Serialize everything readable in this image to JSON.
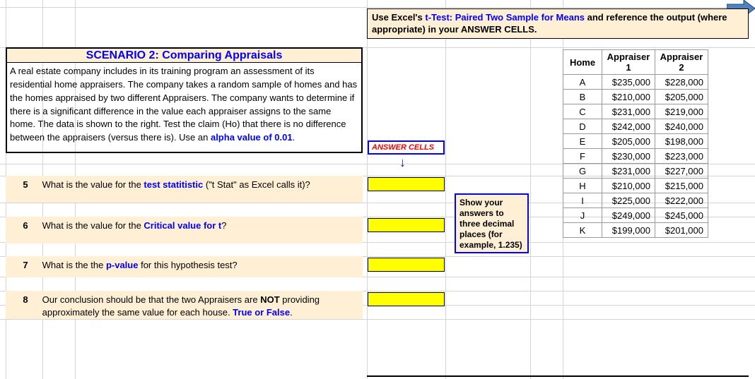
{
  "instruction": {
    "pre": "Use Excel's ",
    "blue": "t-Test: Paired Two Sample for Means",
    "post": " and reference the output (where appropriate) in your ANSWER CELLS."
  },
  "scenario": {
    "title": "SCENARIO 2: Comparing Appraisals",
    "body_pre": "A real estate company includes in its training program an assessment of its residential home appraisers.  The company takes a random sample of homes and has the homes appraised by two different Appraisers.  The company wants to determine if there is a significant difference in the value each appraiser assigns to the same home.  The data is shown to the right.  Test the claim (Ho) that there is no difference between the appraisers (versus there is).  Use an ",
    "body_blue": "alpha value of 0.01",
    "body_post": "."
  },
  "answer_label": "ANSWER CELLS",
  "note": "Show your answers to three decimal places (for example, 1.235)",
  "questions": {
    "q5": {
      "num": "5",
      "pre": "What is the value for the ",
      "blue": "test statitistic",
      "post": " (\"t Stat\" as Excel calls it)?"
    },
    "q6": {
      "num": "6",
      "pre": "What is the value for the ",
      "blue": "Critical value for t",
      "post": "?"
    },
    "q7": {
      "num": "7",
      "pre": "What is the the ",
      "blue": "p-value",
      "post": " for this hypothesis test?"
    },
    "q8": {
      "num": "8",
      "pre1": "Our conclusion should be that the two Appraisers are ",
      "bold": "NOT",
      "pre2": " providing approximately the same value for each house.  ",
      "blue": "True or False",
      "post": "."
    }
  },
  "table": {
    "headers": {
      "h1": "Home",
      "h2": "Appraiser 1",
      "h3": "Appraiser 2"
    },
    "rows": [
      {
        "home": "A",
        "a1": "$235,000",
        "a2": "$228,000"
      },
      {
        "home": "B",
        "a1": "$210,000",
        "a2": "$205,000"
      },
      {
        "home": "C",
        "a1": "$231,000",
        "a2": "$219,000"
      },
      {
        "home": "D",
        "a1": "$242,000",
        "a2": "$240,000"
      },
      {
        "home": "E",
        "a1": "$205,000",
        "a2": "$198,000"
      },
      {
        "home": "F",
        "a1": "$230,000",
        "a2": "$223,000"
      },
      {
        "home": "G",
        "a1": "$231,000",
        "a2": "$227,000"
      },
      {
        "home": "H",
        "a1": "$210,000",
        "a2": "$215,000"
      },
      {
        "home": "I",
        "a1": "$225,000",
        "a2": "$222,000"
      },
      {
        "home": "J",
        "a1": "$249,000",
        "a2": "$245,000"
      },
      {
        "home": "K",
        "a1": "$199,000",
        "a2": "$201,000"
      }
    ]
  }
}
